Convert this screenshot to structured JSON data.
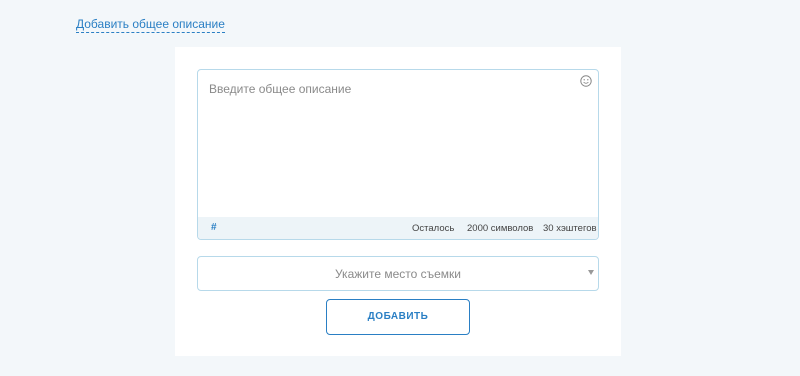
{
  "description_toggle": {
    "label": "Добавить общее описание"
  },
  "editor": {
    "placeholder": "Введите общее описание",
    "value": "",
    "emoji_icon": "smiley-icon",
    "hashtag_icon": "hash-icon",
    "hashtag_symbol": "#",
    "remaining_label": "Осталось",
    "chars_label": "2000 символов",
    "hashtags_label": "30 хэштегов"
  },
  "location": {
    "placeholder": "Укажите место съемки"
  },
  "submit": {
    "label": "ДОБАВИТЬ"
  },
  "colors": {
    "accent": "#2a7fc4",
    "border": "#b7d9ea",
    "page_bg": "#f3f7fa",
    "footer_bg": "#edf4f8"
  }
}
